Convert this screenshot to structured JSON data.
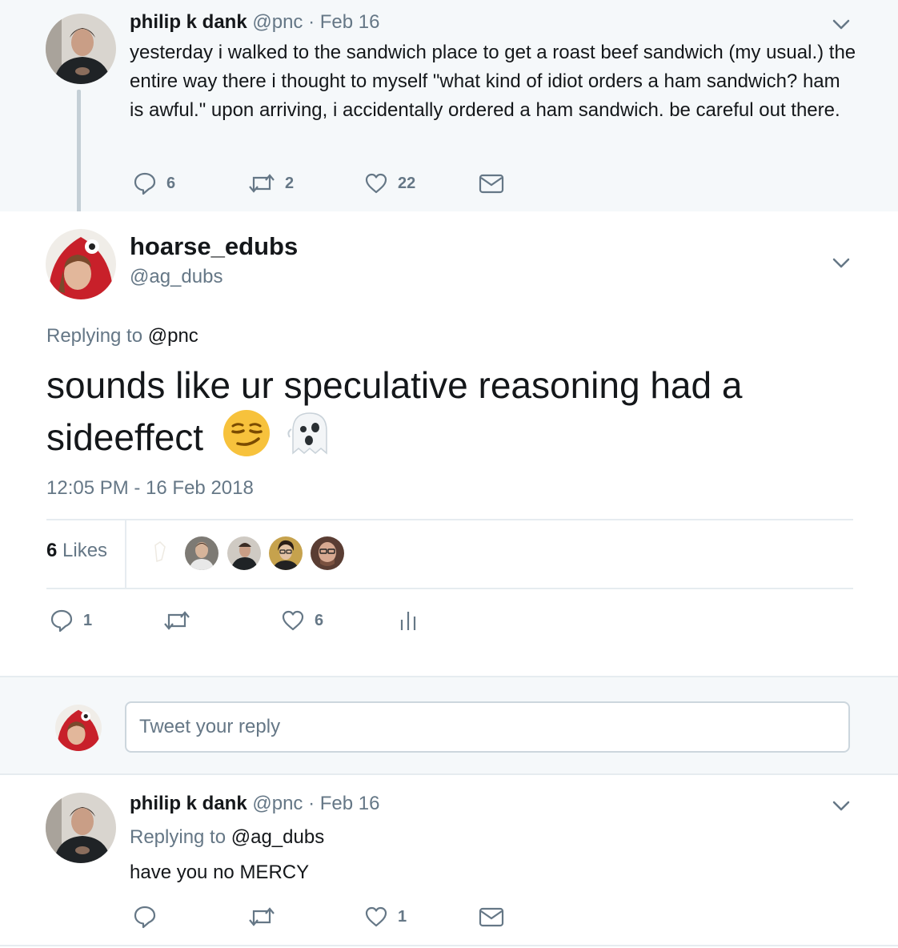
{
  "parent_tweet": {
    "name": "philip k dank",
    "handle": "@pnc",
    "separator": "·",
    "date": "Feb 16",
    "text": "yesterday i walked to the sandwich place to get a roast beef sandwich (my usual.) the entire way there i thought to myself \"what kind of idiot orders a ham sandwich? ham is awful.\" upon arriving, i accidentally ordered a ham sandwich. be careful out there.",
    "replies": "6",
    "retweets": "2",
    "likes": "22"
  },
  "main_tweet": {
    "name": "hoarse_edubs",
    "handle": "@ag_dubs",
    "replying_prefix": "Replying to",
    "replying_to": "@pnc",
    "text": "sounds like ur speculative reasoning had a sideeffect",
    "emojis": [
      "smirking-face",
      "ghost"
    ],
    "timestamp": "12:05 PM - 16 Feb 2018",
    "likes_count": "6",
    "likes_label": "Likes",
    "replies": "1",
    "likes": "6"
  },
  "compose": {
    "placeholder": "Tweet your reply"
  },
  "child_tweet": {
    "name": "philip k dank",
    "handle": "@pnc",
    "separator": "·",
    "date": "Feb 16",
    "replying_prefix": "Replying to",
    "replying_to": "@ag_dubs",
    "text": "have you no MERCY",
    "likes": "1"
  },
  "colors": {
    "muted": "#657786",
    "text": "#14171a",
    "panel_bg": "#f5f8fa",
    "border": "#e6ecf0"
  }
}
